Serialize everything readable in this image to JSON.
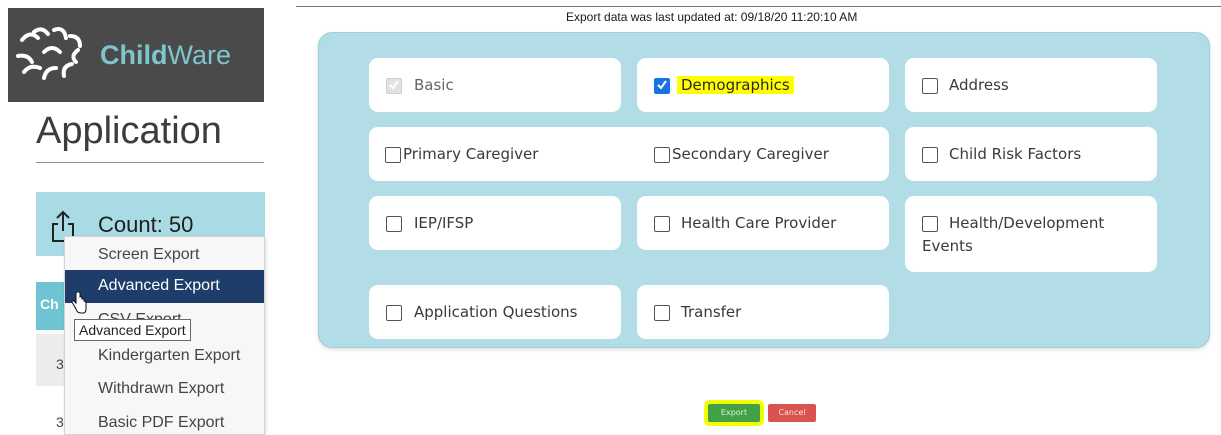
{
  "brand": {
    "name_bold": "Child",
    "name_regular": "Ware",
    "logo_icon": "childware-logo-icon"
  },
  "app": {
    "title": "Application"
  },
  "count": {
    "label": "Count: 50",
    "icon": "share-export-icon"
  },
  "table": {
    "header_partial": "Ch",
    "row1_partial": "3",
    "row2_partial": "3"
  },
  "export_menu": {
    "items": [
      {
        "label": "Screen Export"
      },
      {
        "label": "Advanced Export",
        "state": "active"
      },
      {
        "label": "CSV Export",
        "state": "partially hidden by tooltip"
      },
      {
        "label": "Kindergarten Export"
      },
      {
        "label": "Withdrawn Export"
      },
      {
        "label": "Basic PDF Export"
      }
    ]
  },
  "tooltip": {
    "text": "Advanced Export"
  },
  "cursor": {
    "icon": "hand-pointer-icon"
  },
  "status": {
    "last_updated": "Export data was last updated at: 09/18/20 11:20:10 AM"
  },
  "options": {
    "basic": {
      "label": "Basic",
      "checked": true,
      "disabled": true
    },
    "demographics": {
      "label": "Demographics",
      "checked": true,
      "highlighted": true
    },
    "address": {
      "label": "Address",
      "checked": false
    },
    "primary_caregiver": {
      "label": "Primary Caregiver",
      "checked": false
    },
    "secondary_caregiver": {
      "label": "Secondary Caregiver",
      "checked": false
    },
    "child_risk_factors": {
      "label": "Child Risk Factors",
      "checked": false
    },
    "iep_ifsp": {
      "label": "IEP/IFSP",
      "checked": false
    },
    "health_care_provider": {
      "label": "Health Care Provider",
      "checked": false
    },
    "health_development_line1": {
      "label": "Health/Development"
    },
    "health_development_line2": {
      "label": "Events",
      "checked": false
    },
    "application_questions": {
      "label": "Application Questions",
      "checked": false
    },
    "transfer": {
      "label": "Transfer",
      "checked": false
    }
  },
  "buttons": {
    "export": "Export",
    "cancel": "Cancel"
  },
  "colors": {
    "panel_bg": "#b2dde6",
    "menu_active": "#1f3d6b",
    "checkbox_checked": "#1973e0",
    "highlight": "#ffff00",
    "export_button": "#43a047",
    "cancel_button": "#d9534f"
  }
}
